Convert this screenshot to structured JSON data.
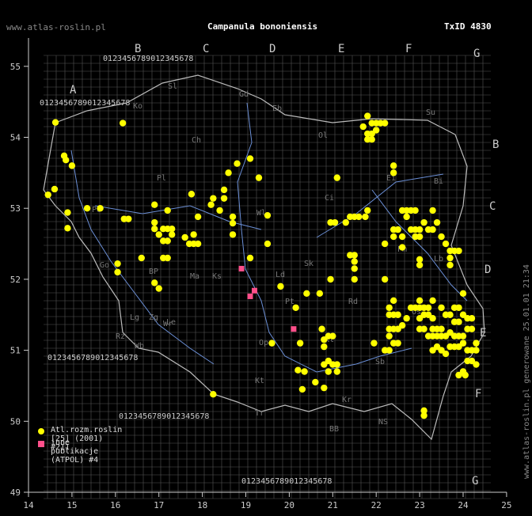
{
  "header": {
    "site": "www.atlas-roslin.pl",
    "title": "Campanula bononiensis",
    "taxid": "TxID 4830"
  },
  "footer_vertical": "www.atlas-roslin.pl generowane 25.01.01 21:34",
  "axes": {
    "x_ticks": [
      "14",
      "15",
      "16",
      "17",
      "18",
      "19",
      "20",
      "21",
      "22",
      "23",
      "24",
      "25"
    ],
    "y_ticks": [
      "49",
      "50",
      "51",
      "52",
      "53",
      "54",
      "55"
    ],
    "x_range": [
      14,
      25
    ],
    "y_range": [
      49,
      55.5
    ]
  },
  "grid_letters": {
    "top": [
      "A",
      "B",
      "C",
      "D",
      "E",
      "F",
      "G"
    ],
    "right": [
      "B",
      "C",
      "D",
      "E",
      "F",
      "G"
    ]
  },
  "grid_digits": "0123456789",
  "region_labels": [
    "Ko",
    "Sl",
    "Gd",
    "Eb",
    "Su",
    "Ch",
    "Ol",
    "Pl",
    "Ei",
    "Bi",
    "Wl",
    "Ci",
    "Po",
    "Pm",
    "Go",
    "Ma",
    "Ld",
    "Sk",
    "Lb",
    "BP",
    "Zg",
    "Le",
    "Ks",
    "Pt",
    "Rd",
    "Wr",
    "Lg",
    "Kl",
    "Os",
    "Wb",
    "Op",
    "Kt",
    "Kr",
    "Tr",
    "BB",
    "NS",
    "Rz",
    "Sb"
  ],
  "legend": [
    {
      "label": "Atl.rozm.roslin [25] (2001) #211",
      "color": "#ffff00",
      "shape": "circle"
    },
    {
      "label": "inne publikacje (ATPOL) #4",
      "color": "#ff4f8a",
      "shape": "square"
    }
  ],
  "chart_data": {
    "type": "scatter",
    "title": "Campanula bononiensis",
    "xlim": [
      14,
      25
    ],
    "ylim": [
      49,
      55.5
    ],
    "series": [
      {
        "name": "Atl.rozm.roslin [25] (2001) #211",
        "color": "#ffff00",
        "points": [
          [
            14.62,
            54.21
          ],
          [
            14.82,
            53.74
          ],
          [
            14.86,
            53.68
          ],
          [
            15.0,
            53.6
          ],
          [
            16.17,
            54.2
          ],
          [
            14.6,
            53.27
          ],
          [
            14.45,
            53.19
          ],
          [
            14.9,
            52.94
          ],
          [
            14.9,
            52.72
          ],
          [
            15.35,
            53.0
          ],
          [
            15.65,
            53.0
          ],
          [
            16.2,
            52.85
          ],
          [
            16.3,
            52.85
          ],
          [
            16.05,
            52.22
          ],
          [
            16.05,
            52.1
          ],
          [
            16.6,
            52.3
          ],
          [
            16.9,
            52.71
          ],
          [
            17.0,
            52.63
          ],
          [
            17.1,
            52.71
          ],
          [
            17.2,
            52.71
          ],
          [
            17.3,
            52.71
          ],
          [
            17.1,
            52.54
          ],
          [
            17.2,
            52.54
          ],
          [
            17.3,
            52.63
          ],
          [
            16.9,
            52.8
          ],
          [
            16.9,
            53.05
          ],
          [
            17.2,
            52.97
          ],
          [
            17.1,
            52.3
          ],
          [
            17.2,
            52.3
          ],
          [
            16.9,
            51.95
          ],
          [
            17.0,
            51.87
          ],
          [
            17.75,
            53.2
          ],
          [
            17.6,
            52.59
          ],
          [
            17.7,
            52.5
          ],
          [
            17.8,
            52.5
          ],
          [
            17.9,
            52.5
          ],
          [
            17.8,
            52.63
          ],
          [
            17.9,
            52.88
          ],
          [
            18.2,
            53.05
          ],
          [
            18.25,
            53.14
          ],
          [
            18.5,
            53.26
          ],
          [
            18.6,
            53.5
          ],
          [
            18.8,
            53.63
          ],
          [
            18.5,
            53.14
          ],
          [
            18.4,
            52.97
          ],
          [
            18.7,
            52.88
          ],
          [
            18.7,
            52.63
          ],
          [
            18.7,
            52.79
          ],
          [
            19.1,
            52.3
          ],
          [
            19.5,
            52.5
          ],
          [
            19.1,
            53.7
          ],
          [
            19.3,
            53.43
          ],
          [
            19.5,
            52.9
          ],
          [
            19.8,
            51.9
          ],
          [
            20.15,
            51.6
          ],
          [
            20.25,
            51.1
          ],
          [
            19.6,
            51.1
          ],
          [
            20.2,
            50.72
          ],
          [
            20.35,
            50.7
          ],
          [
            20.3,
            50.45
          ],
          [
            20.6,
            50.55
          ],
          [
            20.8,
            50.47
          ],
          [
            20.4,
            51.8
          ],
          [
            20.7,
            51.8
          ],
          [
            20.95,
            52.0
          ],
          [
            20.95,
            52.8
          ],
          [
            21.05,
            52.8
          ],
          [
            21.3,
            52.8
          ],
          [
            21.4,
            52.88
          ],
          [
            21.5,
            52.88
          ],
          [
            21.6,
            52.88
          ],
          [
            21.75,
            52.88
          ],
          [
            21.8,
            52.97
          ],
          [
            21.4,
            52.34
          ],
          [
            21.5,
            52.34
          ],
          [
            21.5,
            52.15
          ],
          [
            21.5,
            52.0
          ],
          [
            21.5,
            52.25
          ],
          [
            21.1,
            53.43
          ],
          [
            21.7,
            54.15
          ],
          [
            21.8,
            54.05
          ],
          [
            21.9,
            54.05
          ],
          [
            21.8,
            54.3
          ],
          [
            21.9,
            54.2
          ],
          [
            22.0,
            54.2
          ],
          [
            22.1,
            54.2
          ],
          [
            21.8,
            53.97
          ],
          [
            21.9,
            53.97
          ],
          [
            22.2,
            54.2
          ],
          [
            22.0,
            54.1
          ],
          [
            22.4,
            53.6
          ],
          [
            22.4,
            53.5
          ],
          [
            22.6,
            52.97
          ],
          [
            22.7,
            52.88
          ],
          [
            22.8,
            52.97
          ],
          [
            22.4,
            52.7
          ],
          [
            22.5,
            52.7
          ],
          [
            22.4,
            52.6
          ],
          [
            22.6,
            52.6
          ],
          [
            22.2,
            52.5
          ],
          [
            22.6,
            52.45
          ],
          [
            22.8,
            52.7
          ],
          [
            22.9,
            52.7
          ],
          [
            22.9,
            52.6
          ],
          [
            23.0,
            52.7
          ],
          [
            23.0,
            52.6
          ],
          [
            23.1,
            52.8
          ],
          [
            23.2,
            52.7
          ],
          [
            23.3,
            52.7
          ],
          [
            23.4,
            52.8
          ],
          [
            23.3,
            52.97
          ],
          [
            22.9,
            52.97
          ],
          [
            22.7,
            52.97
          ],
          [
            23.0,
            52.28
          ],
          [
            23.0,
            52.2
          ],
          [
            23.5,
            52.6
          ],
          [
            23.6,
            52.5
          ],
          [
            23.7,
            52.4
          ],
          [
            23.7,
            52.3
          ],
          [
            23.8,
            52.4
          ],
          [
            23.9,
            52.4
          ],
          [
            23.7,
            52.2
          ],
          [
            22.2,
            52.0
          ],
          [
            22.3,
            51.6
          ],
          [
            22.4,
            51.7
          ],
          [
            22.3,
            51.5
          ],
          [
            22.4,
            51.5
          ],
          [
            22.5,
            51.5
          ],
          [
            22.3,
            51.3
          ],
          [
            22.4,
            51.3
          ],
          [
            22.5,
            51.3
          ],
          [
            22.3,
            51.2
          ],
          [
            22.4,
            51.1
          ],
          [
            22.5,
            51.1
          ],
          [
            22.3,
            51.0
          ],
          [
            22.2,
            51.0
          ],
          [
            21.95,
            51.1
          ],
          [
            22.6,
            51.35
          ],
          [
            22.7,
            51.45
          ],
          [
            22.8,
            51.6
          ],
          [
            22.9,
            51.6
          ],
          [
            23.0,
            51.45
          ],
          [
            23.1,
            51.5
          ],
          [
            23.2,
            51.5
          ],
          [
            23.3,
            51.45
          ],
          [
            23.0,
            51.3
          ],
          [
            23.1,
            51.3
          ],
          [
            23.3,
            51.3
          ],
          [
            23.4,
            51.3
          ],
          [
            23.5,
            51.3
          ],
          [
            23.2,
            51.2
          ],
          [
            23.3,
            51.2
          ],
          [
            23.4,
            51.2
          ],
          [
            23.5,
            51.2
          ],
          [
            23.6,
            51.2
          ],
          [
            23.7,
            51.25
          ],
          [
            23.8,
            51.2
          ],
          [
            23.9,
            51.2
          ],
          [
            24.0,
            51.2
          ],
          [
            23.0,
            51.6
          ],
          [
            23.0,
            51.7
          ],
          [
            23.1,
            51.6
          ],
          [
            23.2,
            51.6
          ],
          [
            23.3,
            51.7
          ],
          [
            23.5,
            51.6
          ],
          [
            23.6,
            51.5
          ],
          [
            23.7,
            51.5
          ],
          [
            23.8,
            51.6
          ],
          [
            23.9,
            51.6
          ],
          [
            24.0,
            51.5
          ],
          [
            24.1,
            51.45
          ],
          [
            24.2,
            51.45
          ],
          [
            24.0,
            51.8
          ],
          [
            23.8,
            51.4
          ],
          [
            23.9,
            51.4
          ],
          [
            24.1,
            51.3
          ],
          [
            24.2,
            51.3
          ],
          [
            23.3,
            51.0
          ],
          [
            23.4,
            51.05
          ],
          [
            23.5,
            51.0
          ],
          [
            23.6,
            50.95
          ],
          [
            23.7,
            51.05
          ],
          [
            23.8,
            51.05
          ],
          [
            23.9,
            51.05
          ],
          [
            24.0,
            51.1
          ],
          [
            24.1,
            51.0
          ],
          [
            24.2,
            51.0
          ],
          [
            24.3,
            51.0
          ],
          [
            24.3,
            51.1
          ],
          [
            24.1,
            50.85
          ],
          [
            24.2,
            50.85
          ],
          [
            24.0,
            50.7
          ],
          [
            23.9,
            50.65
          ],
          [
            24.05,
            50.65
          ],
          [
            24.3,
            50.8
          ],
          [
            20.75,
            51.3
          ],
          [
            20.8,
            51.15
          ],
          [
            20.9,
            51.2
          ],
          [
            21.0,
            51.2
          ],
          [
            20.8,
            51.05
          ],
          [
            20.9,
            50.85
          ],
          [
            20.8,
            50.8
          ],
          [
            21.0,
            50.8
          ],
          [
            21.1,
            50.8
          ],
          [
            20.9,
            50.7
          ],
          [
            21.1,
            50.7
          ],
          [
            18.25,
            50.38
          ],
          [
            23.1,
            50.15
          ],
          [
            23.1,
            50.08
          ]
        ]
      },
      {
        "name": "inne publikacje (ATPOL) #4",
        "color": "#ff4f8a",
        "points": [
          [
            18.9,
            52.15
          ],
          [
            19.1,
            51.76
          ],
          [
            19.2,
            51.84
          ],
          [
            20.1,
            51.3
          ]
        ]
      }
    ]
  }
}
